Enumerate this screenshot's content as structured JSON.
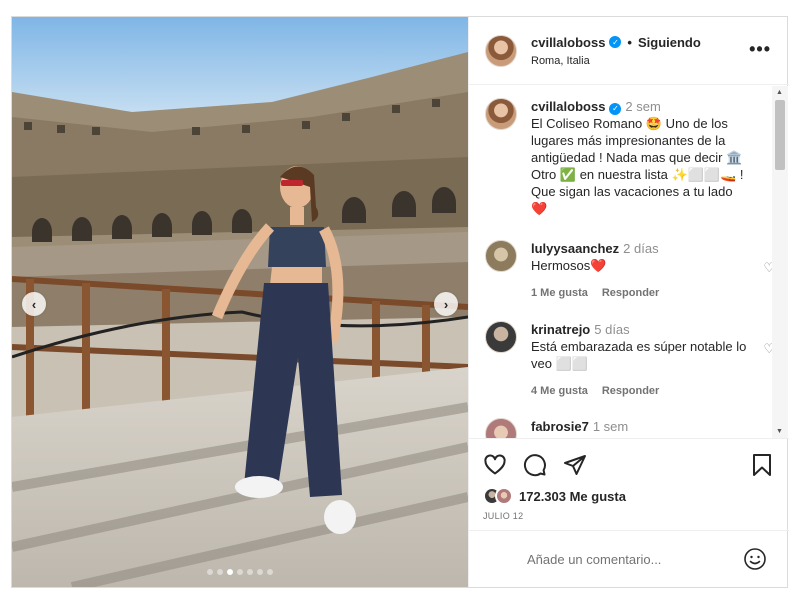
{
  "post": {
    "username": "cvillaloboss",
    "follow_sep": "•",
    "follow_status": "Siguiendo",
    "location": "Roma, Italia",
    "more_label": "•••"
  },
  "carousel": {
    "slides": 7,
    "active_slide": 3
  },
  "caption": {
    "username": "cvillaloboss",
    "time": "2 sem",
    "text": "El Coliseo Romano 🤩 Uno de los lugares más impresionantes de la antigüedad ! Nada mas que decir 🏛️ Otro ✅ en nuestra lista ✨⬜⬜🚤 ! Que sigan las vacaciones a tu lado ❤️"
  },
  "comments": [
    {
      "username": "lulyysaanchez",
      "time": "2 días",
      "text": "Hermosos❤️",
      "likes": "1 Me gusta",
      "reply": "Responder"
    },
    {
      "username": "krinatrejo",
      "time": "5 días",
      "text": "Está embarazada es súper notable lo veo ⬜⬜",
      "likes": "4 Me gusta",
      "reply": "Responder"
    },
    {
      "username": "fabrosie7",
      "time": "1 sem",
      "text": "",
      "likes": "",
      "reply": ""
    }
  ],
  "stats": {
    "likes": "172.303 Me gusta",
    "date": "JULIO 12"
  },
  "composer": {
    "placeholder": "Añade un comentario..."
  },
  "icons": [
    "heart-icon",
    "comment-icon",
    "share-icon",
    "bookmark-icon",
    "emoji-icon"
  ]
}
